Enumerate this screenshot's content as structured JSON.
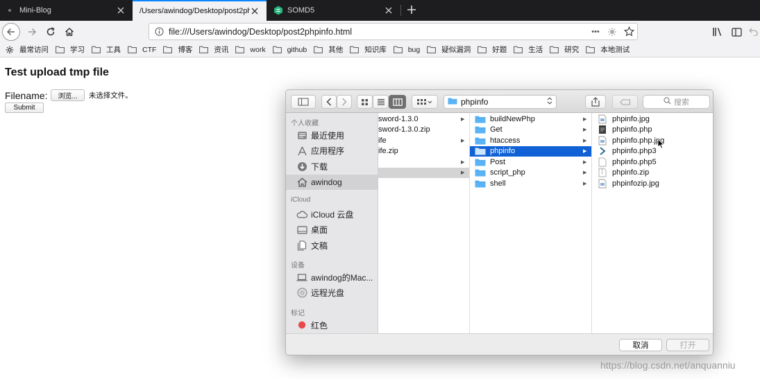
{
  "tabs": [
    {
      "title": "Mini-Blog",
      "active": false
    },
    {
      "title": "/Users/awindog/Desktop/post2phpi",
      "active": true
    },
    {
      "title": "SOMD5",
      "active": false
    }
  ],
  "address": {
    "url": "file:///Users/awindog/Desktop/post2phpinfo.html",
    "more": "•••"
  },
  "bookmarks": [
    {
      "label": "最常访问",
      "icon": "gear-icon"
    },
    {
      "label": "学习",
      "icon": "folder-icon"
    },
    {
      "label": "工具",
      "icon": "folder-icon"
    },
    {
      "label": "CTF",
      "icon": "folder-icon"
    },
    {
      "label": "博客",
      "icon": "folder-icon"
    },
    {
      "label": "资讯",
      "icon": "folder-icon"
    },
    {
      "label": "work",
      "icon": "folder-icon"
    },
    {
      "label": "github",
      "icon": "folder-icon"
    },
    {
      "label": "其他",
      "icon": "folder-icon"
    },
    {
      "label": "知识库",
      "icon": "folder-icon"
    },
    {
      "label": "bug",
      "icon": "folder-icon"
    },
    {
      "label": "疑似漏洞",
      "icon": "folder-icon"
    },
    {
      "label": "好题",
      "icon": "folder-icon"
    },
    {
      "label": "生活",
      "icon": "folder-icon"
    },
    {
      "label": "研究",
      "icon": "folder-icon"
    },
    {
      "label": "本地测试",
      "icon": "folder-icon"
    }
  ],
  "page": {
    "title": "Test upload tmp file",
    "filename_label": "Filename:",
    "browse_label": "浏览...",
    "no_file_label": "未选择文件。",
    "submit_label": "Submit"
  },
  "dialog": {
    "path": "phpinfo",
    "search_placeholder": "搜索",
    "sidebar": {
      "favorites_header": "个人收藏",
      "favorites": [
        {
          "label": "最近使用",
          "icon": "recents-icon"
        },
        {
          "label": "应用程序",
          "icon": "applications-icon"
        },
        {
          "label": "下载",
          "icon": "downloads-icon"
        },
        {
          "label": "awindog",
          "icon": "home-icon",
          "selected": true
        }
      ],
      "icloud_header": "iCloud",
      "icloud": [
        {
          "label": "iCloud 云盘",
          "icon": "cloud-icon"
        },
        {
          "label": "桌面",
          "icon": "desktop-icon"
        },
        {
          "label": "文稿",
          "icon": "documents-icon"
        }
      ],
      "devices_header": "设备",
      "devices": [
        {
          "label": "awindog的Mac...",
          "icon": "laptop-icon"
        },
        {
          "label": "远程光盘",
          "icon": "disc-icon"
        }
      ],
      "tags_header": "标记",
      "tags": [
        {
          "label": "红色",
          "icon": "red-tag-icon",
          "color": "#e84a4a"
        }
      ]
    },
    "column1": [
      {
        "label": "sword-1.3.0",
        "folder": true
      },
      {
        "label": "sword-1.3.0.zip",
        "folder": false
      },
      {
        "label": "ife",
        "folder": true
      },
      {
        "label": "ife.zip",
        "folder": false
      },
      {
        "label": "",
        "folder": true
      },
      {
        "label": "",
        "folder": true,
        "highlight": true
      }
    ],
    "column2": [
      {
        "label": "buildNewPhp"
      },
      {
        "label": "Get"
      },
      {
        "label": "htaccess"
      },
      {
        "label": "phpinfo",
        "selected": true
      },
      {
        "label": "Post"
      },
      {
        "label": "script_php"
      },
      {
        "label": "shell"
      }
    ],
    "column3": [
      {
        "label": "phpinfo.jpg",
        "icon": "image-file-icon"
      },
      {
        "label": "phpinfo.php",
        "icon": "php-file-icon"
      },
      {
        "label": "phpinfo.php.jpg",
        "icon": "image-file-icon"
      },
      {
        "label": "phpinfo.php3",
        "icon": "script-file-icon"
      },
      {
        "label": "phpinfo.php5",
        "icon": "file-icon"
      },
      {
        "label": "phpinfo.zip",
        "icon": "zip-file-icon"
      },
      {
        "label": "phpinfozip.jpg",
        "icon": "image-file-icon"
      }
    ],
    "cancel_label": "取消",
    "open_label": "打开"
  },
  "watermark": "https://blog.csdn.net/anquanniu",
  "colors": {
    "accent": "#0a84ff",
    "selection": "#1061d5",
    "folder": "#5ab3f4"
  }
}
